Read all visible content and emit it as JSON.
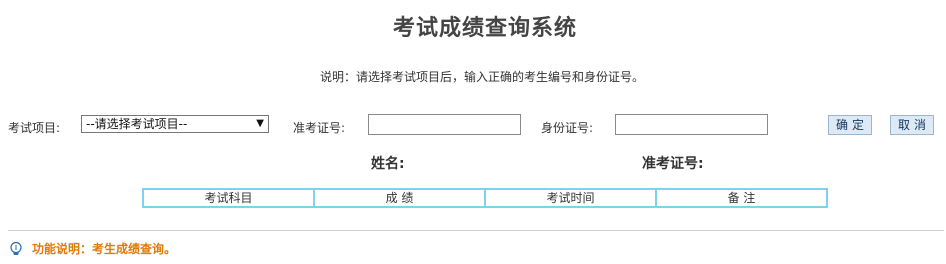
{
  "page": {
    "title": "考试成绩查询系统",
    "instruction": "说明：请选择考试项目后，输入正确的考生编号和身份证号。"
  },
  "form": {
    "exam_item_label": "考试项目:",
    "exam_item_selected": "--请选择考试项目--",
    "admission_label": "准考证号:",
    "admission_value": "",
    "id_label": "身份证号:",
    "id_value": "",
    "confirm_label": "确定",
    "cancel_label": "取消"
  },
  "result": {
    "name_label": "姓名:",
    "admission_label": "准考证号:",
    "columns": [
      "考试科目",
      "成 绩",
      "考试时间",
      "备 注"
    ]
  },
  "footer": {
    "function_note": "功能说明：考生成绩查询。",
    "icon": "lightbulb-icon"
  },
  "colors": {
    "table_border": "#7cd3ec",
    "function_note": "#e07b0a",
    "button_bg": "#dde9f5"
  }
}
